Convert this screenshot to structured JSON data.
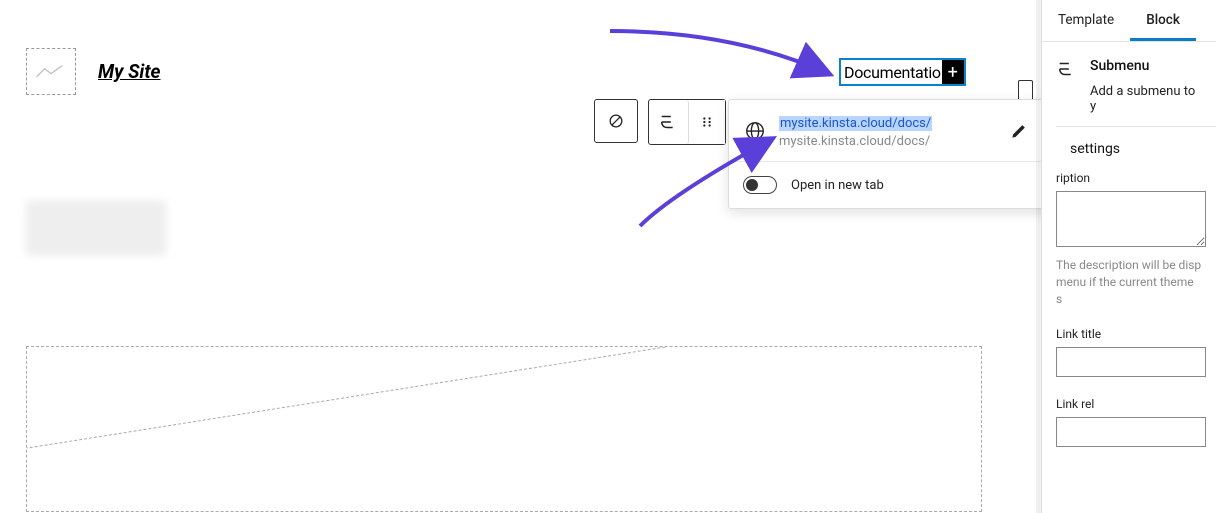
{
  "site_title": "My Site",
  "nav": {
    "item_label": "Documentatio",
    "add_icon_glyph": "+"
  },
  "link_popup": {
    "url": "mysite.kinsta.cloud/docs/",
    "path": "mysite.kinsta.cloud/docs/",
    "open_new_tab_label": "Open in new tab",
    "open_new_tab_value": false
  },
  "sidebar": {
    "tabs": {
      "template": "Template",
      "block": "Block"
    },
    "block_name": "Submenu",
    "block_desc": "Add a submenu to y",
    "settings_heading": "settings",
    "description_field_label": "ription",
    "description_hint": "The description will be disp menu if the current theme s",
    "link_title_label": "Link title",
    "link_rel_label": "Link rel"
  }
}
